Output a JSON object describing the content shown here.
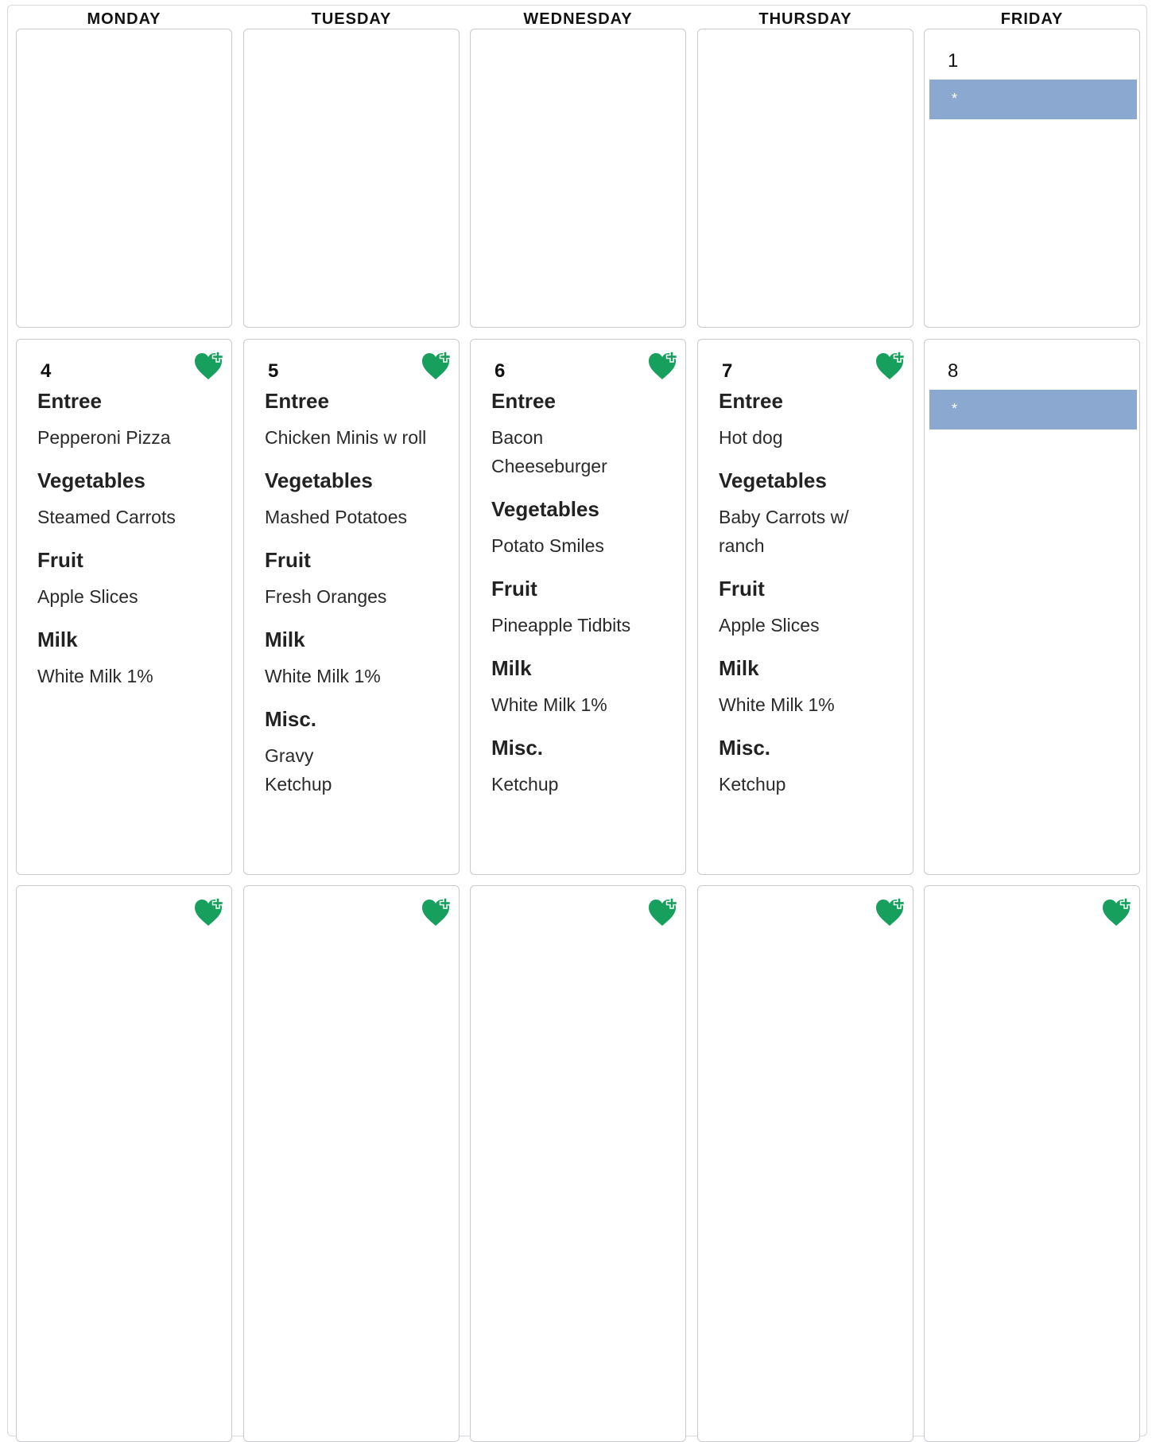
{
  "weekdays": [
    "MONDAY",
    "TUESDAY",
    "WEDNESDAY",
    "THURSDAY",
    "FRIDAY"
  ],
  "week1": {
    "friday": {
      "day": "1",
      "note": "*"
    }
  },
  "week2": {
    "monday": {
      "day": "4",
      "entree_label": "Entree",
      "entree": "Pepperoni Pizza",
      "vegetables_label": "Vegetables",
      "vegetables": "Steamed Carrots",
      "fruit_label": "Fruit",
      "fruit": "Apple Slices",
      "milk_label": "Milk",
      "milk": "White Milk 1%"
    },
    "tuesday": {
      "day": "5",
      "entree_label": "Entree",
      "entree": "Chicken Minis w roll",
      "vegetables_label": "Vegetables",
      "vegetables": "Mashed Potatoes",
      "fruit_label": "Fruit",
      "fruit": "Fresh Oranges",
      "milk_label": "Milk",
      "milk": "White Milk 1%",
      "misc_label": "Misc.",
      "misc": [
        "Gravy",
        "Ketchup"
      ]
    },
    "wednesday": {
      "day": "6",
      "entree_label": "Entree",
      "entree": [
        "Bacon",
        "Cheeseburger"
      ],
      "vegetables_label": "Vegetables",
      "vegetables": "Potato Smiles",
      "fruit_label": "Fruit",
      "fruit": "Pineapple Tidbits",
      "milk_label": "Milk",
      "milk": "White Milk 1%",
      "misc_label": "Misc.",
      "misc": "Ketchup"
    },
    "thursday": {
      "day": "7",
      "entree_label": "Entree",
      "entree": "Hot dog",
      "vegetables_label": "Vegetables",
      "vegetables": [
        "Baby Carrots w/",
        "ranch"
      ],
      "fruit_label": "Fruit",
      "fruit": "Apple Slices",
      "milk_label": "Milk",
      "milk": "White Milk 1%",
      "misc_label": "Misc.",
      "misc": "Ketchup"
    },
    "friday": {
      "day": "8",
      "note": "*"
    }
  },
  "colors": {
    "heart": "#17a05d",
    "note_bar": "#8aa8d0",
    "border": "#c9c9d2"
  },
  "icons": {
    "healthy": "heart-plus-icon"
  }
}
